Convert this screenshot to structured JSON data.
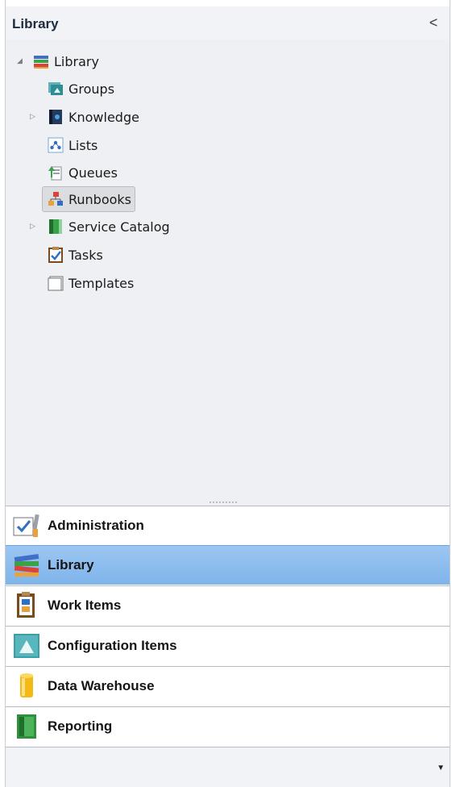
{
  "header": {
    "title": "Library",
    "collapse_glyph": "<"
  },
  "tree": {
    "root": {
      "label": "Library",
      "icon": "library-icon",
      "expander": "◢"
    },
    "items": [
      {
        "label": "Groups",
        "icon": "groups-icon",
        "expander": ""
      },
      {
        "label": "Knowledge",
        "icon": "knowledge-icon",
        "expander": "▷"
      },
      {
        "label": "Lists",
        "icon": "lists-icon",
        "expander": ""
      },
      {
        "label": "Queues",
        "icon": "queues-icon",
        "expander": ""
      },
      {
        "label": "Runbooks",
        "icon": "runbooks-icon",
        "expander": "",
        "selected": true
      },
      {
        "label": "Service Catalog",
        "icon": "service-catalog-icon",
        "expander": "▷"
      },
      {
        "label": "Tasks",
        "icon": "tasks-icon",
        "expander": ""
      },
      {
        "label": "Templates",
        "icon": "templates-icon",
        "expander": ""
      }
    ]
  },
  "splitter": {
    "grip": "·········"
  },
  "workspaces": [
    {
      "label": "Administration",
      "icon": "administration-icon",
      "active": false
    },
    {
      "label": "Library",
      "icon": "library-icon",
      "active": true
    },
    {
      "label": "Work Items",
      "icon": "work-items-icon",
      "active": false
    },
    {
      "label": "Configuration Items",
      "icon": "configuration-items-icon",
      "active": false
    },
    {
      "label": "Data Warehouse",
      "icon": "data-warehouse-icon",
      "active": false
    },
    {
      "label": "Reporting",
      "icon": "reporting-icon",
      "active": false
    }
  ],
  "overflow": {
    "arrow": "▼"
  },
  "colors": {
    "active_blue": "#8dbdee",
    "panel_bg": "#eef0f3",
    "border": "#b6bcc4"
  }
}
